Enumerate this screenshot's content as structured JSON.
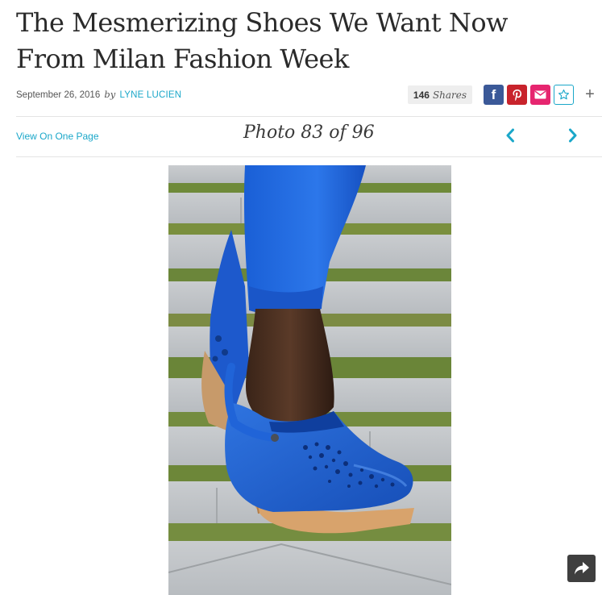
{
  "article": {
    "title": "The Mesmerizing Shoes We Want Now From Milan Fashion Week",
    "date": "September 26, 2016",
    "by": "by",
    "author": "LYNE LUCIEN"
  },
  "share": {
    "count": "146",
    "label": "Shares",
    "buttons": [
      {
        "name": "facebook",
        "glyph": "f",
        "color": "#3b5998"
      },
      {
        "name": "pinterest",
        "color": "#c8232c"
      },
      {
        "name": "email",
        "color": "#e6256f"
      },
      {
        "name": "favorite",
        "color": "#1aa7c9"
      }
    ],
    "more": "+"
  },
  "gallery": {
    "view_one_page": "View On One Page",
    "counter": "Photo 83 of 96",
    "current": 83,
    "total": 96,
    "photo_description": "Blue leather perforated wedge clog with wooden sole, worn with blue cropped trousers, on a stone and grass path"
  },
  "colors": {
    "accent": "#1aa7c9",
    "facebook": "#3b5998",
    "pinterest": "#c8232c",
    "email": "#e6256f",
    "shoe_blue": "#1e5fcf"
  }
}
